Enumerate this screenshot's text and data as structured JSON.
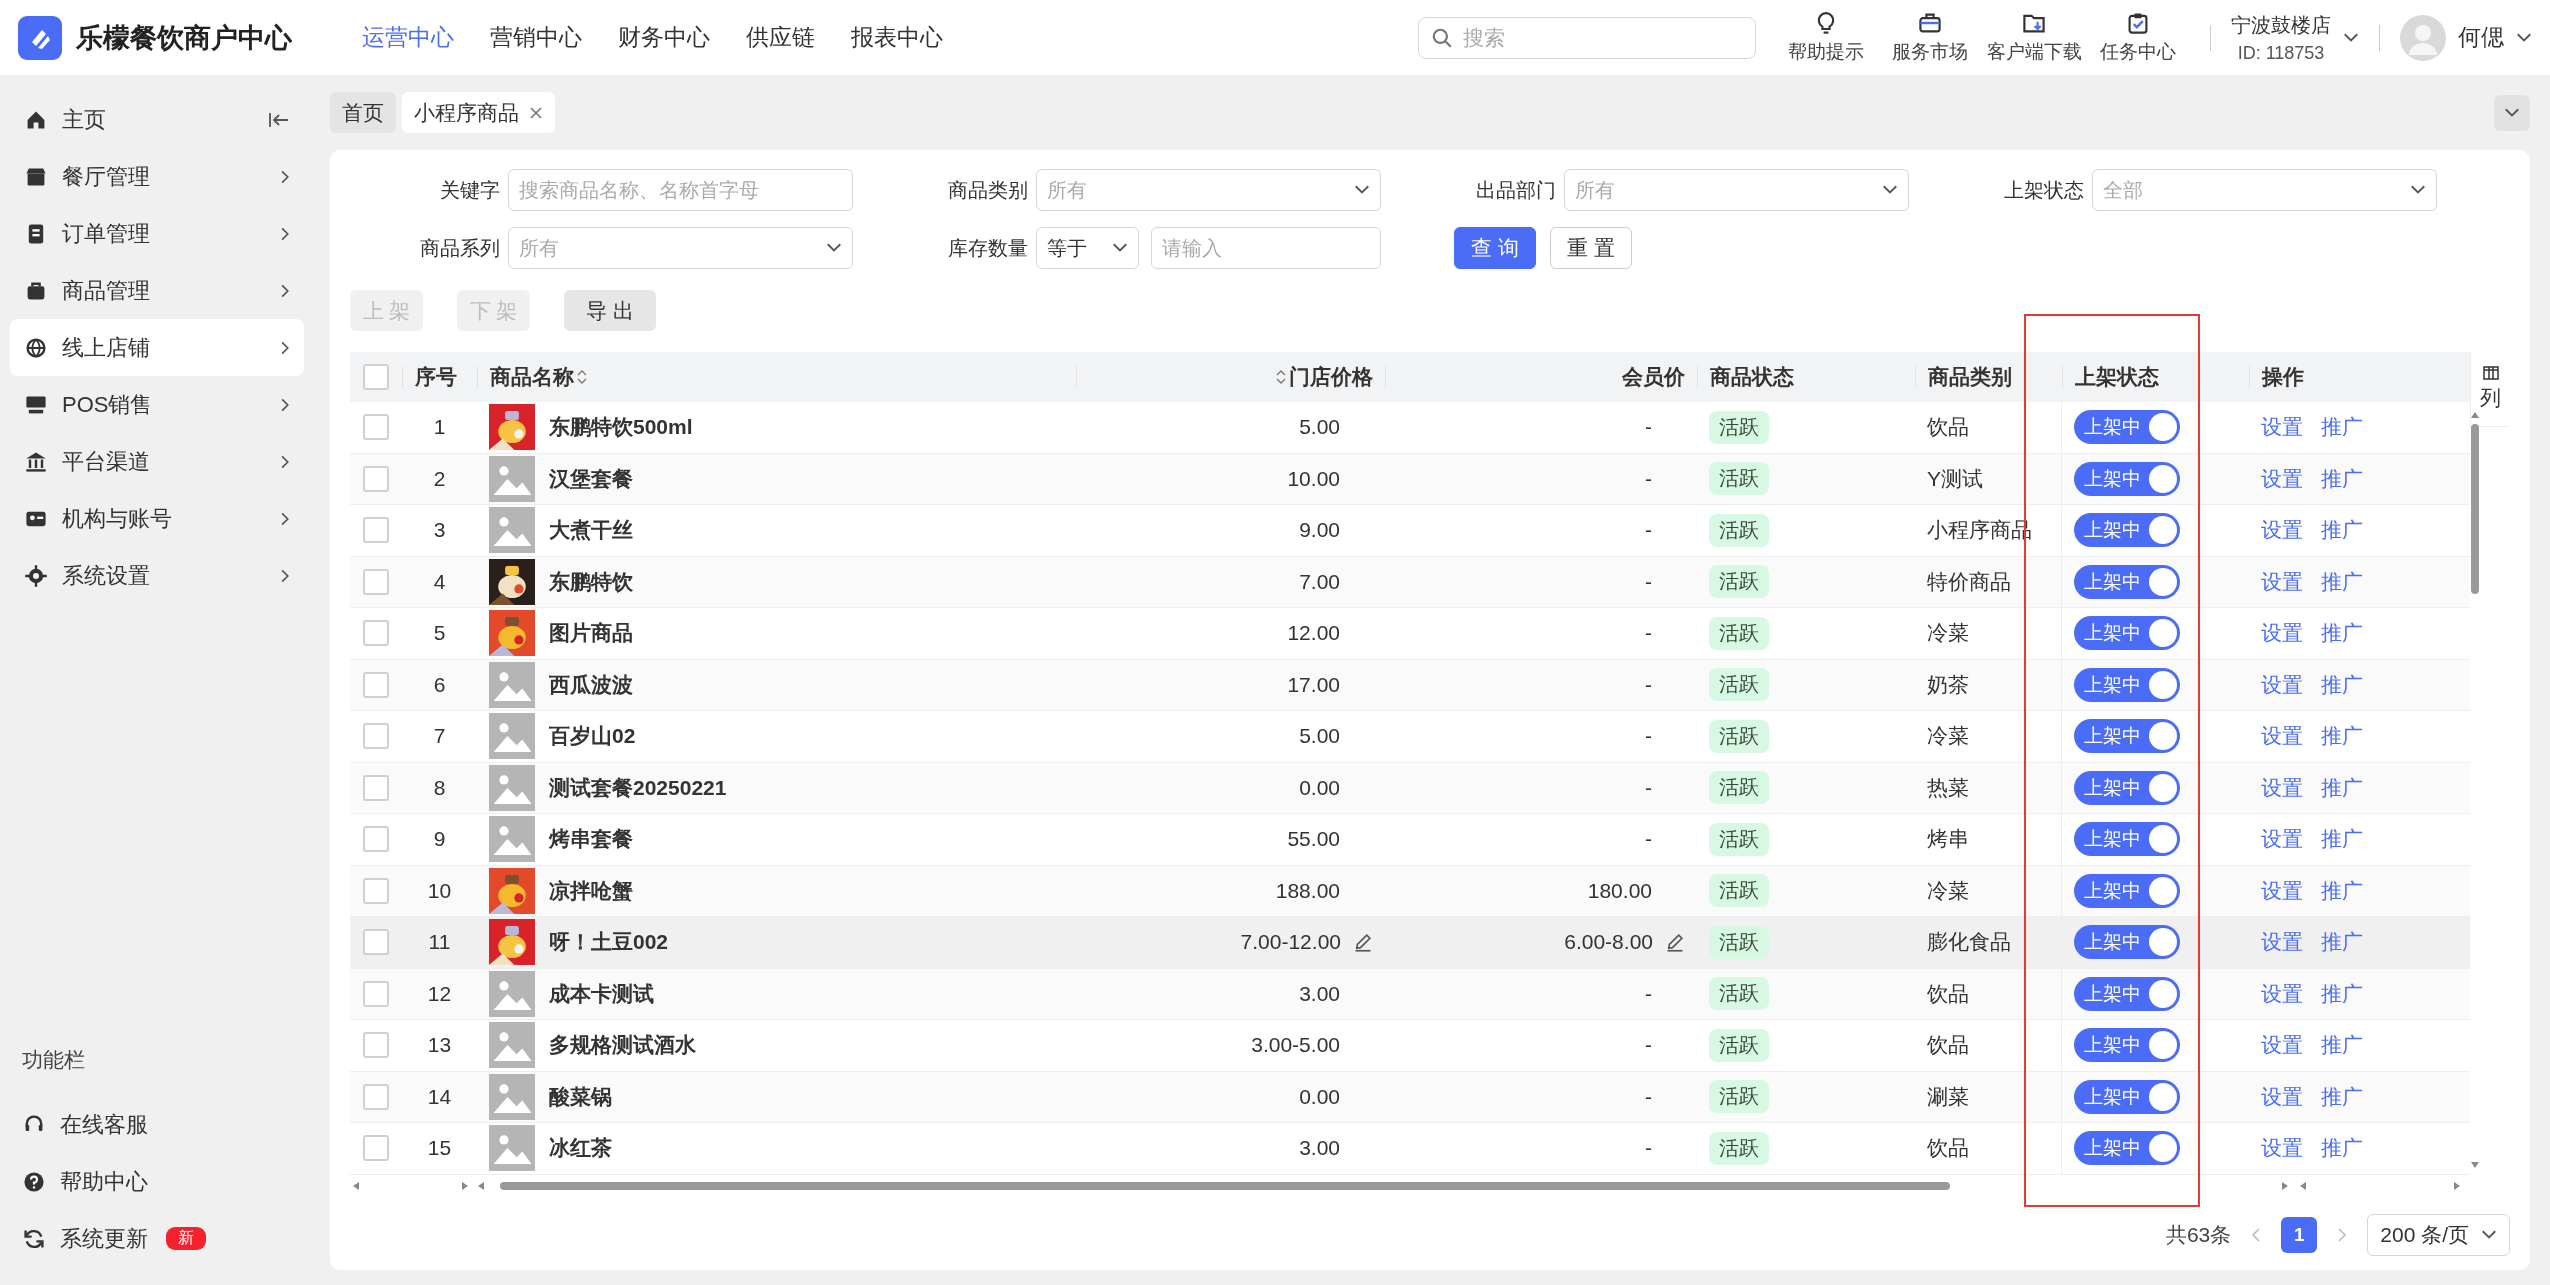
{
  "app": {
    "title": "乐檬餐饮商户中心"
  },
  "nav": [
    {
      "label": "运营中心",
      "selected": true
    },
    {
      "label": "营销中心",
      "selected": false
    },
    {
      "label": "财务中心",
      "selected": false
    },
    {
      "label": "供应链",
      "selected": false
    },
    {
      "label": "报表中心",
      "selected": false
    }
  ],
  "search": {
    "placeholder": "搜索"
  },
  "tools": [
    {
      "kind": "bulb",
      "label": "帮助提示"
    },
    {
      "kind": "bag",
      "label": "服务市场"
    },
    {
      "kind": "download",
      "label": "客户端下载"
    },
    {
      "kind": "task",
      "label": "任务中心"
    }
  ],
  "store": {
    "name": "宁波鼓楼店",
    "id": "ID: 118753"
  },
  "user": {
    "name": "何偲"
  },
  "sidebar": {
    "items": [
      {
        "kind": "home",
        "label": "主页",
        "selected": false
      },
      {
        "kind": "shop",
        "label": "餐厅管理",
        "selected": false
      },
      {
        "kind": "order",
        "label": "订单管理",
        "selected": false
      },
      {
        "kind": "goods",
        "label": "商品管理",
        "selected": false
      },
      {
        "kind": "globe",
        "label": "线上店铺",
        "selected": true
      },
      {
        "kind": "pos",
        "label": "POS销售",
        "selected": false
      },
      {
        "kind": "bank",
        "label": "平台渠道",
        "selected": false
      },
      {
        "kind": "org",
        "label": "机构与账号",
        "selected": false
      },
      {
        "kind": "gear",
        "label": "系统设置",
        "selected": false
      }
    ],
    "footer_title": "功能栏",
    "footer": [
      {
        "kind": "service",
        "label": "在线客服"
      },
      {
        "kind": "help",
        "label": "帮助中心"
      },
      {
        "kind": "update",
        "label": "系统更新",
        "badge": "新"
      }
    ]
  },
  "page_tabs": [
    {
      "label": "首页",
      "selected": false,
      "closable": false
    },
    {
      "label": "小程序商品",
      "selected": true,
      "closable": true
    }
  ],
  "filters": {
    "row_1": [
      {
        "label": "关键字",
        "kind": "input",
        "placeholder": "搜索商品名称、名称首字母"
      },
      {
        "label": "商品类别",
        "kind": "select",
        "placeholder": "所有"
      },
      {
        "label": "出品部门",
        "kind": "select",
        "placeholder": "所有"
      },
      {
        "label": "上架状态",
        "kind": "select",
        "placeholder": "全部"
      }
    ],
    "series": {
      "label": "商品系列",
      "placeholder": "所有"
    },
    "stock": {
      "label": "库存数量",
      "operator": "等于",
      "placeholder": "请输入"
    },
    "query_button": "查 询",
    "reset_button": "重 置"
  },
  "actions": [
    {
      "label": "上 架",
      "disabled": true
    },
    {
      "label": "下 架",
      "disabled": true
    },
    {
      "label": "导 出",
      "disabled": false
    }
  ],
  "table": {
    "select_all": {
      "checked": false
    },
    "columns": [
      "序号",
      "商品名称",
      "门店价格",
      "会员价",
      "商品状态",
      "商品类别",
      "上架状态",
      "操作"
    ],
    "column_tool": "列",
    "rows": [
      {
        "checked": false,
        "no": "1",
        "kind": "picture",
        "name": "东鹏特饮500ml",
        "price": "5.00",
        "member_price": "-",
        "status": "活跃",
        "category": "饮品",
        "listed": true,
        "listed_label": "上架中",
        "hover": false,
        "actions": [
          "设置",
          "推广"
        ]
      },
      {
        "checked": false,
        "no": "2",
        "kind": "placeholder",
        "name": "汉堡套餐",
        "price": "10.00",
        "member_price": "-",
        "status": "活跃",
        "category": "Y测试",
        "listed": true,
        "listed_label": "上架中",
        "hover": false,
        "actions": [
          "设置",
          "推广"
        ]
      },
      {
        "checked": false,
        "no": "3",
        "kind": "placeholder",
        "name": "大煮干丝",
        "price": "9.00",
        "member_price": "-",
        "status": "活跃",
        "category": "小程序商品",
        "listed": true,
        "listed_label": "上架中",
        "hover": false,
        "actions": [
          "设置",
          "推广"
        ]
      },
      {
        "checked": false,
        "no": "4",
        "kind": "picture",
        "name": "东鹏特饮",
        "price": "7.00",
        "member_price": "-",
        "status": "活跃",
        "category": "特价商品",
        "listed": true,
        "listed_label": "上架中",
        "hover": false,
        "actions": [
          "设置",
          "推广"
        ]
      },
      {
        "checked": false,
        "no": "5",
        "kind": "picture",
        "name": "图片商品",
        "price": "12.00",
        "member_price": "-",
        "status": "活跃",
        "category": "冷菜",
        "listed": true,
        "listed_label": "上架中",
        "hover": false,
        "actions": [
          "设置",
          "推广"
        ]
      },
      {
        "checked": false,
        "no": "6",
        "kind": "placeholder",
        "name": "西瓜波波",
        "price": "17.00",
        "member_price": "-",
        "status": "活跃",
        "category": "奶茶",
        "listed": true,
        "listed_label": "上架中",
        "hover": false,
        "actions": [
          "设置",
          "推广"
        ]
      },
      {
        "checked": false,
        "no": "7",
        "kind": "placeholder",
        "name": "百岁山02",
        "price": "5.00",
        "member_price": "-",
        "status": "活跃",
        "category": "冷菜",
        "listed": true,
        "listed_label": "上架中",
        "hover": false,
        "actions": [
          "设置",
          "推广"
        ]
      },
      {
        "checked": false,
        "no": "8",
        "kind": "placeholder",
        "name": "测试套餐20250221",
        "price": "0.00",
        "member_price": "-",
        "status": "活跃",
        "category": "热菜",
        "listed": true,
        "listed_label": "上架中",
        "hover": false,
        "actions": [
          "设置",
          "推广"
        ]
      },
      {
        "checked": false,
        "no": "9",
        "kind": "placeholder",
        "name": "烤串套餐",
        "price": "55.00",
        "member_price": "-",
        "status": "活跃",
        "category": "烤串",
        "listed": true,
        "listed_label": "上架中",
        "hover": false,
        "actions": [
          "设置",
          "推广"
        ]
      },
      {
        "checked": false,
        "no": "10",
        "kind": "picture",
        "name": "凉拌呛蟹",
        "price": "188.00",
        "member_price": "180.00",
        "status": "活跃",
        "category": "冷菜",
        "listed": true,
        "listed_label": "上架中",
        "hover": false,
        "actions": [
          "设置",
          "推广"
        ]
      },
      {
        "checked": false,
        "no": "11",
        "kind": "picture",
        "name": "呀！土豆002",
        "price": "7.00-12.00",
        "member_price": "6.00-8.00",
        "status": "活跃",
        "category": "膨化食品",
        "listed": true,
        "listed_label": "上架中",
        "hover": true,
        "actions": [
          "设置",
          "推广"
        ]
      },
      {
        "checked": false,
        "no": "12",
        "kind": "placeholder",
        "name": "成本卡测试",
        "price": "3.00",
        "member_price": "-",
        "status": "活跃",
        "category": "饮品",
        "listed": true,
        "listed_label": "上架中",
        "hover": false,
        "actions": [
          "设置",
          "推广"
        ]
      },
      {
        "checked": false,
        "no": "13",
        "kind": "placeholder",
        "name": "多规格测试酒水",
        "price": "3.00-5.00",
        "member_price": "-",
        "status": "活跃",
        "category": "饮品",
        "listed": true,
        "listed_label": "上架中",
        "hover": false,
        "actions": [
          "设置",
          "推广"
        ]
      },
      {
        "checked": false,
        "no": "14",
        "kind": "placeholder",
        "name": "酸菜锅",
        "price": "0.00",
        "member_price": "-",
        "status": "活跃",
        "category": "涮菜",
        "listed": true,
        "listed_label": "上架中",
        "hover": false,
        "actions": [
          "设置",
          "推广"
        ]
      },
      {
        "checked": false,
        "no": "15",
        "kind": "placeholder",
        "name": "冰红茶",
        "price": "3.00",
        "member_price": "-",
        "status": "活跃",
        "category": "饮品",
        "listed": true,
        "listed_label": "上架中",
        "hover": false,
        "actions": [
          "设置",
          "推广"
        ]
      }
    ]
  },
  "pagination": {
    "total": "共63条",
    "pages": [
      {
        "label": "1",
        "selected": true
      }
    ],
    "page_size": "200 条/页"
  }
}
